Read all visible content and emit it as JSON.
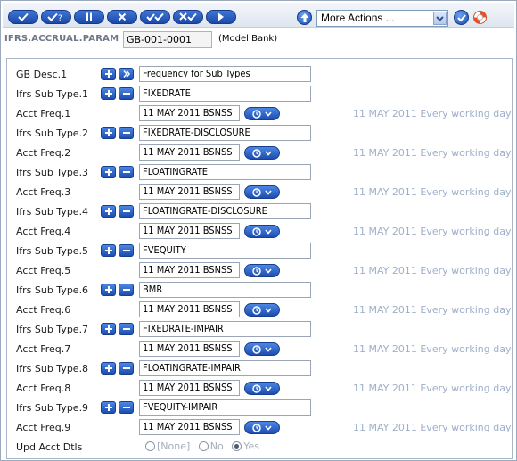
{
  "toolbar": {
    "buttons": [
      "commit",
      "validate",
      "hold",
      "delete",
      "authorise",
      "reverse",
      "next"
    ],
    "more_actions": "More Actions ...",
    "icons": [
      "up-arrow-icon",
      "go-check-icon",
      "help-lifebuoy-icon"
    ]
  },
  "header": {
    "application": "IFRS.ACCRUAL.PARAM",
    "record_id": "GB-001-0001",
    "company": "(Model Bank)"
  },
  "form": {
    "gb_desc": {
      "label": "GB Desc.1",
      "value": "Frequency for Sub Types"
    },
    "entries": [
      {
        "type_label": "Ifrs Sub Type.1",
        "type_value": "FIXEDRATE",
        "freq_label": "Acct Freq.1",
        "freq_value": "11 MAY 2011 BSNSS",
        "freq_enrich": "11 MAY 2011 Every working day"
      },
      {
        "type_label": "Ifrs Sub Type.2",
        "type_value": "FIXEDRATE-DISCLOSURE",
        "freq_label": "Acct Freq.2",
        "freq_value": "11 MAY 2011 BSNSS",
        "freq_enrich": "11 MAY 2011 Every working day"
      },
      {
        "type_label": "Ifrs Sub Type.3",
        "type_value": "FLOATINGRATE",
        "freq_label": "Acct Freq.3",
        "freq_value": "11 MAY 2011 BSNSS",
        "freq_enrich": "11 MAY 2011 Every working day"
      },
      {
        "type_label": "Ifrs Sub Type.4",
        "type_value": "FLOATINGRATE-DISCLOSURE",
        "freq_label": "Acct Freq.4",
        "freq_value": "11 MAY 2011 BSNSS",
        "freq_enrich": "11 MAY 2011 Every working day"
      },
      {
        "type_label": "Ifrs Sub Type.5",
        "type_value": "FVEQUITY",
        "freq_label": "Acct Freq.5",
        "freq_value": "11 MAY 2011 BSNSS",
        "freq_enrich": "11 MAY 2011 Every working day"
      },
      {
        "type_label": "Ifrs Sub Type.6",
        "type_value": "BMR",
        "freq_label": "Acct Freq.6",
        "freq_value": "11 MAY 2011 BSNSS",
        "freq_enrich": "11 MAY 2011 Every working day"
      },
      {
        "type_label": "Ifrs Sub Type.7",
        "type_value": "FIXEDRATE-IMPAIR",
        "freq_label": "Acct Freq.7",
        "freq_value": "11 MAY 2011 BSNSS",
        "freq_enrich": "11 MAY 2011 Every working day"
      },
      {
        "type_label": "Ifrs Sub Type.8",
        "type_value": "FLOATINGRATE-IMPAIR",
        "freq_label": "Acct Freq.8",
        "freq_value": "11 MAY 2011 BSNSS",
        "freq_enrich": "11 MAY 2011 Every working day"
      },
      {
        "type_label": "Ifrs Sub Type.9",
        "type_value": "FVEQUITY-IMPAIR",
        "freq_label": "Acct Freq.9",
        "freq_value": "11 MAY 2011 BSNSS",
        "freq_enrich": "11 MAY 2011 Every working day"
      }
    ],
    "upd_acct_dtls": {
      "label": "Upd Acct Dtls",
      "options": [
        "[None]",
        "No",
        "Yes"
      ],
      "selected": "Yes"
    }
  },
  "colors": {
    "button_blue": "#1d4eb1",
    "enrichment_text": "#9fb0c9",
    "header_grey": "#6d7787"
  }
}
